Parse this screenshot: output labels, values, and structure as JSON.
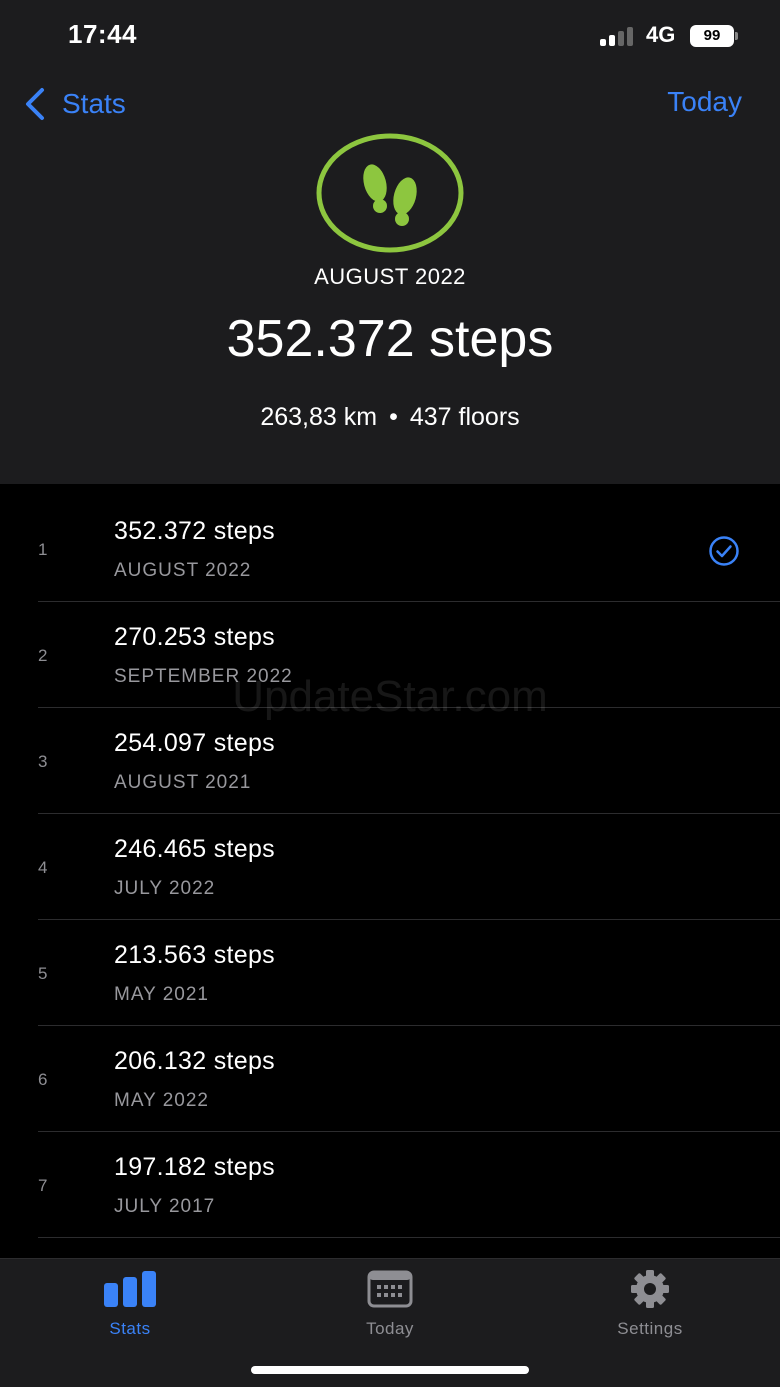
{
  "status_bar": {
    "time": "17:44",
    "network": "4G",
    "battery": "99"
  },
  "nav": {
    "back_label": "Stats",
    "right_label": "Today"
  },
  "summary": {
    "month": "AUGUST 2022",
    "total_steps": "352.372 steps",
    "distance": "263,83 km",
    "separator": "•",
    "floors": "437 floors"
  },
  "ranking": [
    {
      "rank": "1",
      "steps": "352.372 steps",
      "month": "AUGUST 2022",
      "selected": true
    },
    {
      "rank": "2",
      "steps": "270.253 steps",
      "month": "SEPTEMBER 2022"
    },
    {
      "rank": "3",
      "steps": "254.097 steps",
      "month": "AUGUST 2021"
    },
    {
      "rank": "4",
      "steps": "246.465 steps",
      "month": "JULY 2022"
    },
    {
      "rank": "5",
      "steps": "213.563 steps",
      "month": "MAY 2021"
    },
    {
      "rank": "6",
      "steps": "206.132 steps",
      "month": "MAY 2022"
    },
    {
      "rank": "7",
      "steps": "197.182 steps",
      "month": "JULY 2017"
    }
  ],
  "watermark": "UpdateStar.com",
  "tabs": [
    {
      "label": "Stats",
      "icon": "bar-chart-icon",
      "active": true
    },
    {
      "label": "Today",
      "icon": "calendar-icon",
      "active": false
    },
    {
      "label": "Settings",
      "icon": "gear-icon",
      "active": false
    }
  ],
  "colors": {
    "accent": "#3a82f7",
    "badge": "#8dc63f",
    "background": "#000000",
    "header": "#1c1c1e",
    "inactive": "#8e8e93"
  }
}
